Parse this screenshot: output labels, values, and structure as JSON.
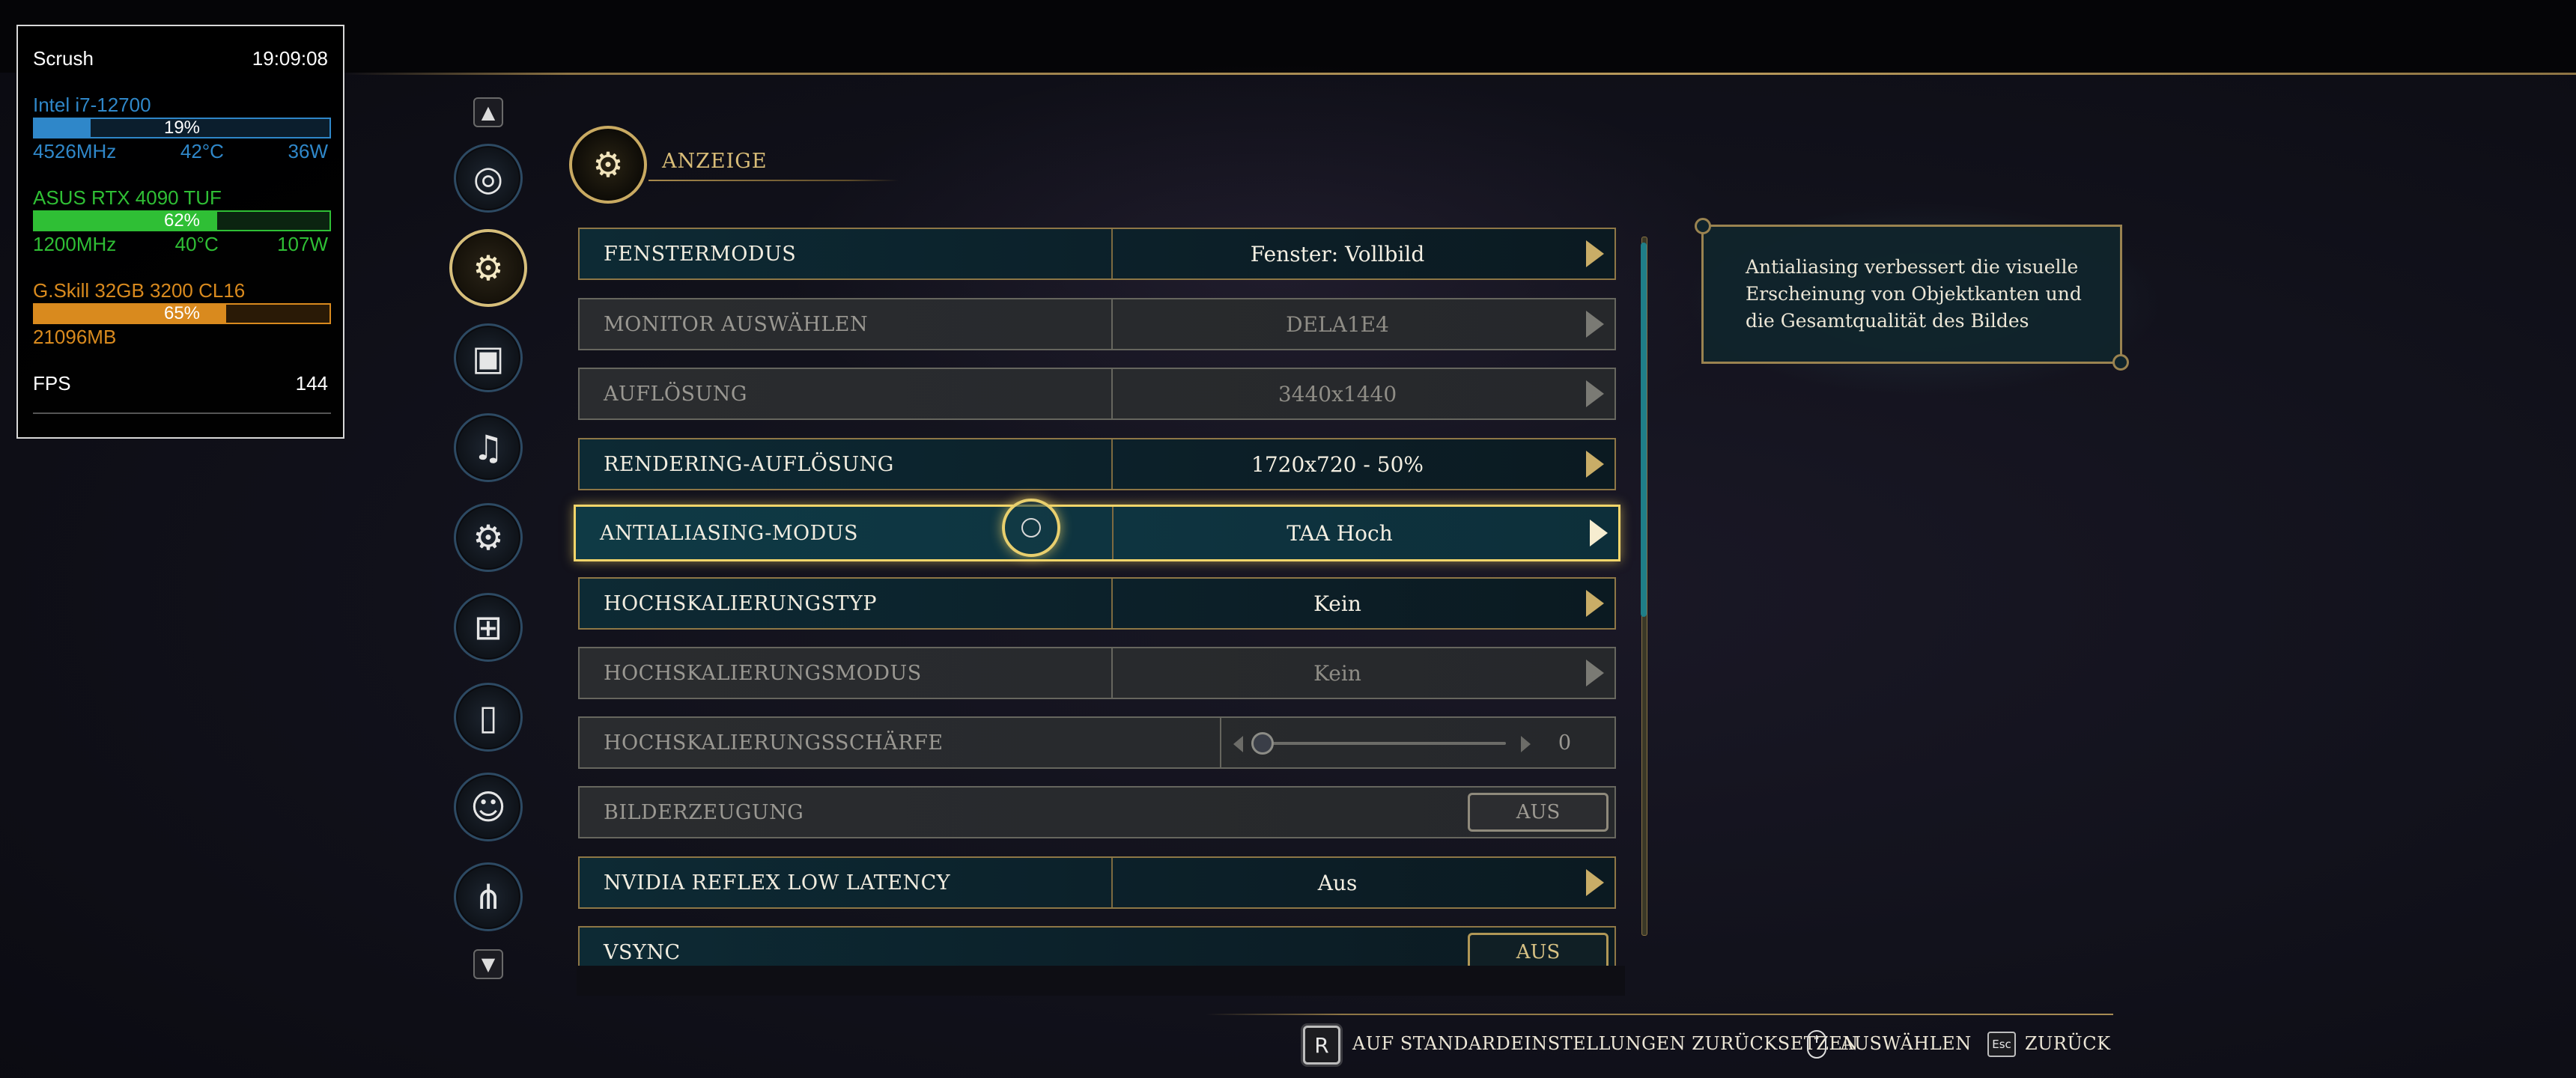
{
  "overlay": {
    "title": "Scrush",
    "time": "19:09:08",
    "cpu": {
      "name": "Intel i7-12700",
      "pct": "19%",
      "pct_value": 0.19,
      "clock": "4526MHz",
      "temp": "42°C",
      "power": "36W",
      "color": "#2f87c9"
    },
    "gpu": {
      "name": "ASUS RTX 4090 TUF",
      "pct": "62%",
      "pct_value": 0.62,
      "clock": "1200MHz",
      "temp": "40°C",
      "power": "107W",
      "color": "#2fbf35"
    },
    "ram": {
      "name": "G.Skill 32GB 3200 CL16",
      "pct": "65%",
      "pct_value": 0.65,
      "used": "21096MB",
      "color": "#d98a1e"
    },
    "fps_label": "FPS",
    "fps_value": "144"
  },
  "nav": {
    "items": [
      {
        "icon": "disc-icon",
        "glyph": "◎"
      },
      {
        "icon": "display-settings-icon",
        "glyph": "⚙",
        "active": true
      },
      {
        "icon": "image-icon",
        "glyph": "▣"
      },
      {
        "icon": "speaker-icon",
        "glyph": "♫"
      },
      {
        "icon": "gear-icon",
        "glyph": "⚙"
      },
      {
        "icon": "gamepad-icon",
        "glyph": "⊞"
      },
      {
        "icon": "mouse-icon",
        "glyph": "▯"
      },
      {
        "icon": "accessibility-icon",
        "glyph": "☺"
      },
      {
        "icon": "network-icon",
        "glyph": "⋔"
      }
    ]
  },
  "section": {
    "title": "ANZEIGE"
  },
  "settings": {
    "fenstermodus": {
      "label": "FENSTERMODUS",
      "value": "Fenster: Vollbild"
    },
    "monitor": {
      "label": "MONITOR AUSWÄHLEN",
      "value": "DELA1E4"
    },
    "aufloesung": {
      "label": "AUFLÖSUNG",
      "value": "3440x1440"
    },
    "rendering": {
      "label": "RENDERING-AUFLÖSUNG",
      "value": "1720x720 - 50%"
    },
    "antialiasing": {
      "label": "ANTIALIASING-MODUS",
      "value": "TAA Hoch"
    },
    "hochskalierungstyp": {
      "label": "HOCHSKALIERUNGSTYP",
      "value": "Kein"
    },
    "hochskalierungsmodus": {
      "label": "HOCHSKALIERUNGSMODUS",
      "value": "Kein"
    },
    "schaerfe": {
      "label": "HOCHSKALIERUNGSSCHÄRFE",
      "value": "0",
      "slider_value": 0
    },
    "bilderzeugung": {
      "label": "BILDERZEUGUNG",
      "value": "AUS"
    },
    "reflex": {
      "label": "NVIDIA REFLEX LOW LATENCY",
      "value": "Aus"
    },
    "vsync": {
      "label": "VSYNC",
      "value": "AUS"
    }
  },
  "tooltip": {
    "text": "Antialiasing verbessert die visuelle Erscheinung von Objektkanten und die Gesamtqualität des Bildes"
  },
  "footer": {
    "reset_key": "R",
    "reset_label": "AUF STANDARDEINSTELLUNGEN ZURÜCKSETZEN",
    "select_label": "AUSWÄHLEN",
    "back_key": "Esc",
    "back_label": "ZURÜCK"
  }
}
